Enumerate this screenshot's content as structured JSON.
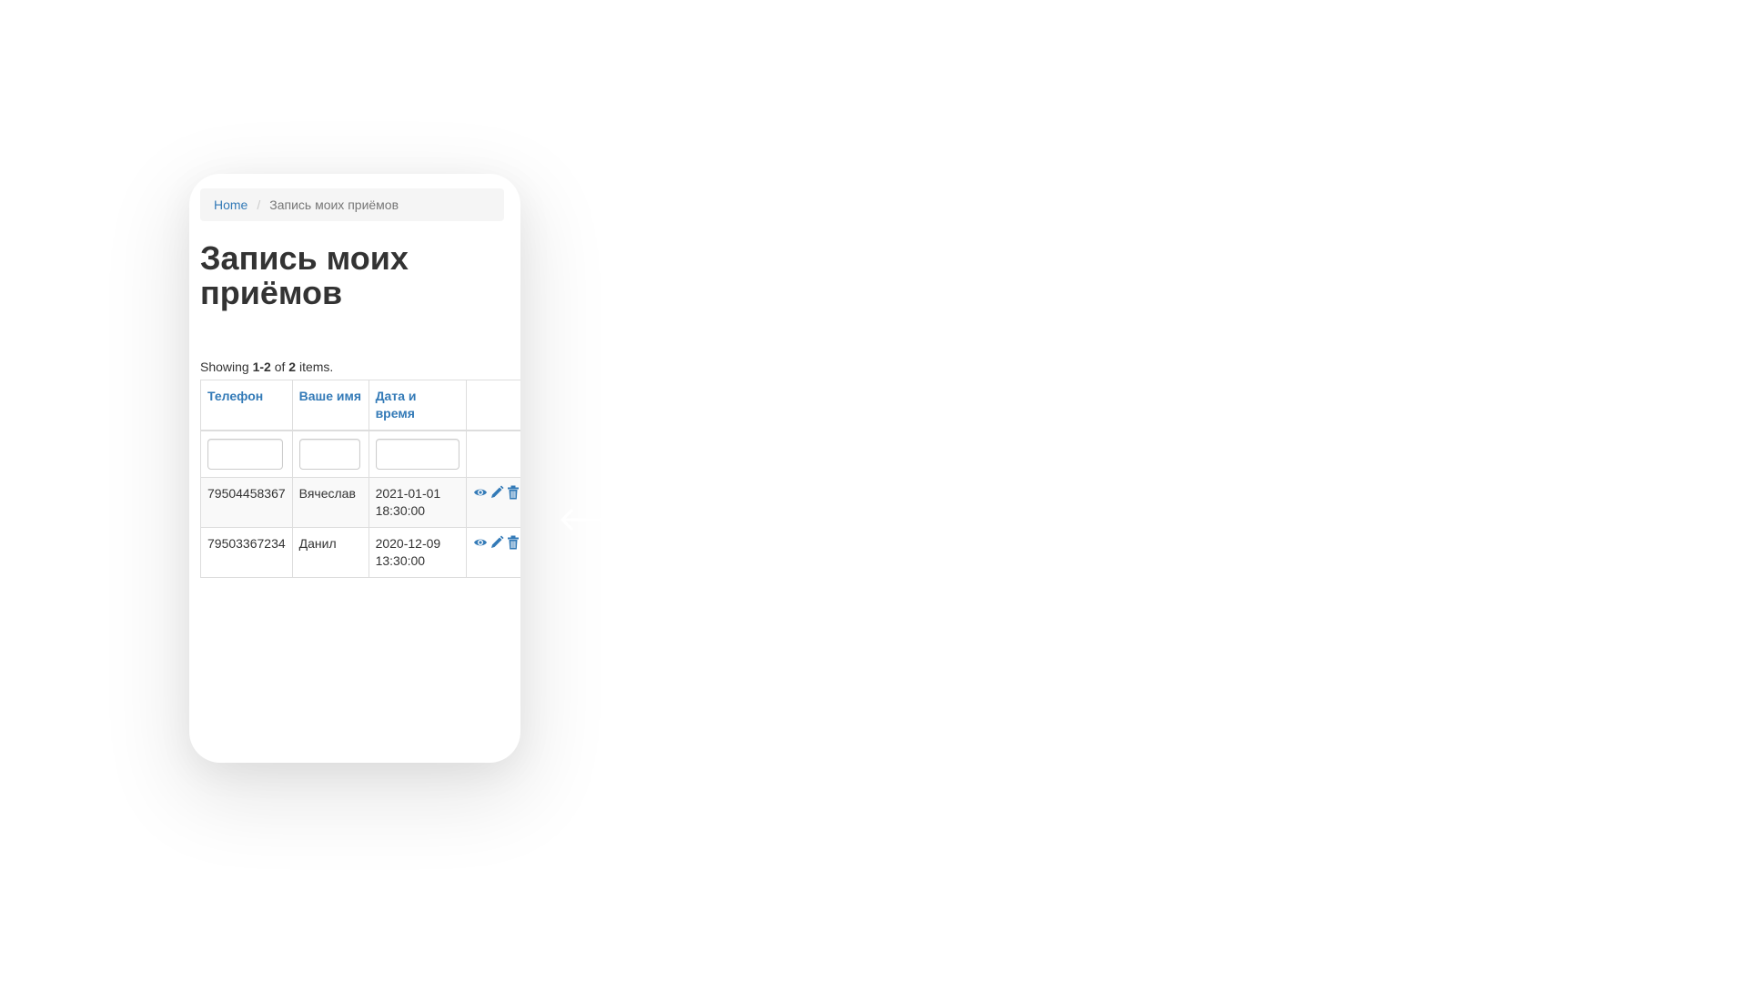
{
  "breadcrumb": {
    "home": "Home",
    "separator": "/",
    "current": "Запись моих приёмов"
  },
  "page": {
    "title": "Запись моих приёмов"
  },
  "summary": {
    "prefix": "Showing ",
    "range": "1-2",
    "of": " of ",
    "total": "2",
    "suffix": " items."
  },
  "table": {
    "columns": [
      "Телефон",
      "Ваше имя",
      "Дата и время",
      ""
    ],
    "rows": [
      {
        "phone": "79504458367",
        "name": "Вячеслав",
        "datetime": "2021-01-01 18:30:00"
      },
      {
        "phone": "79503367234",
        "name": "Данил",
        "datetime": "2020-12-09 13:30:00"
      }
    ],
    "actions": [
      "eye-icon",
      "pencil-icon",
      "trash-icon"
    ]
  },
  "colors": {
    "link": "#337ab7",
    "text": "#333333",
    "breadcrumb_bg": "#f5f5f5",
    "border": "#dddddd"
  }
}
